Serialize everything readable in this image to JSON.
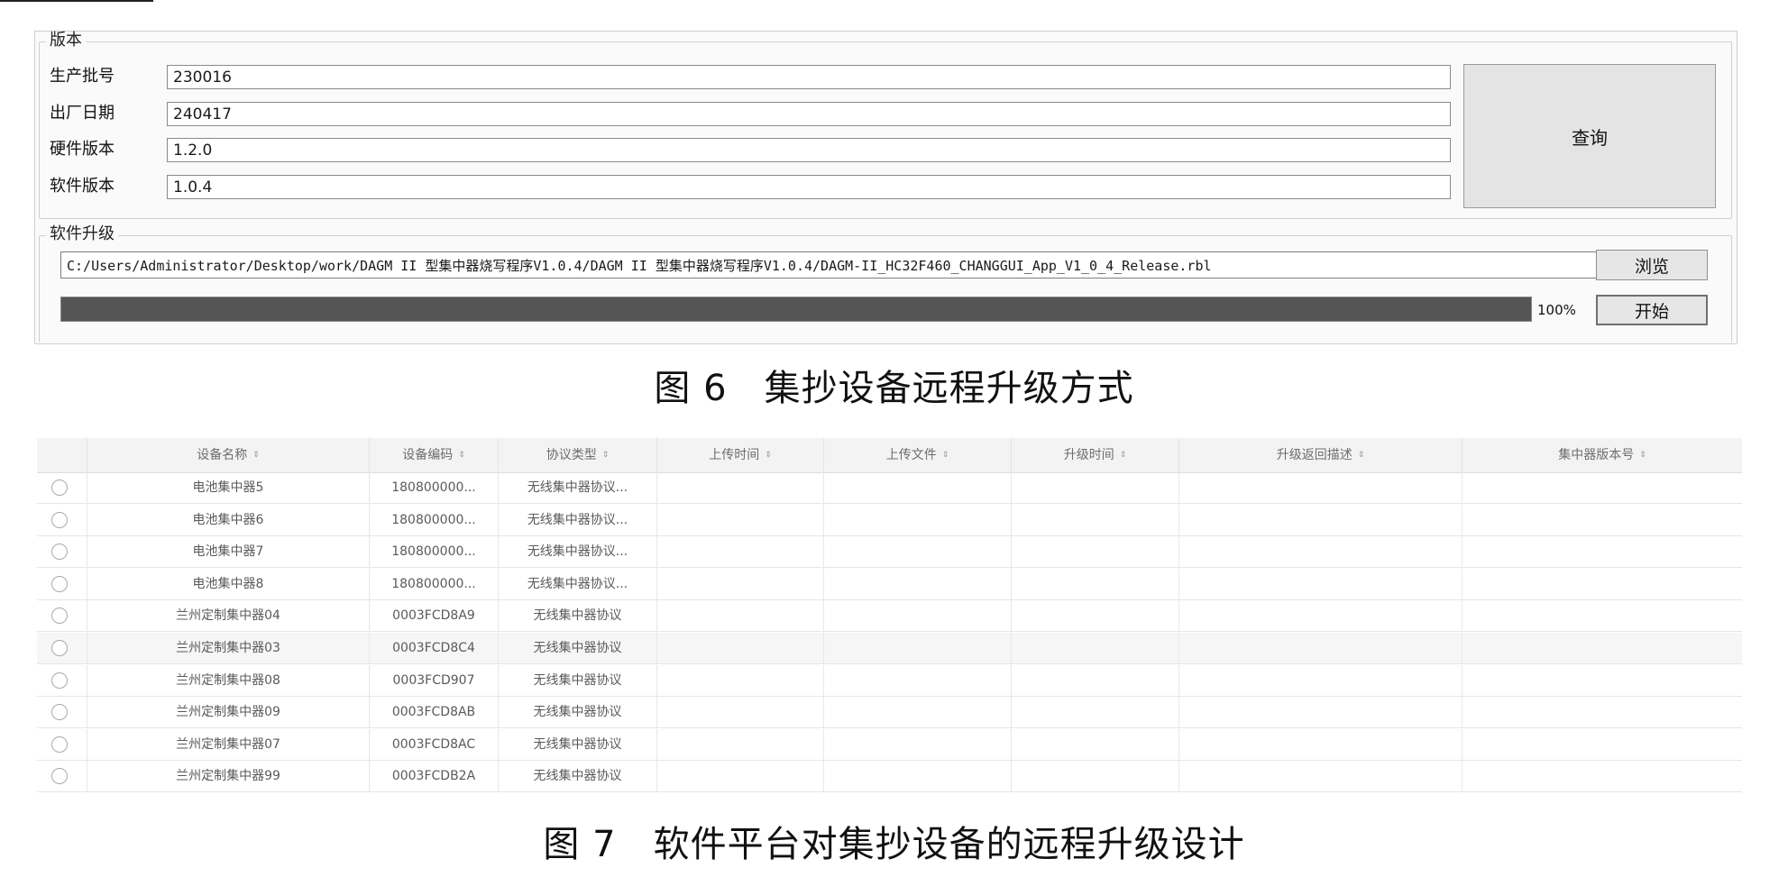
{
  "version_panel": {
    "group_title": "版本",
    "fields": [
      {
        "label": "生产批号",
        "value": "230016"
      },
      {
        "label": "出厂日期",
        "value": "240417"
      },
      {
        "label": "硬件版本",
        "value": "1.2.0"
      },
      {
        "label": "软件版本",
        "value": "1.0.4"
      }
    ],
    "query_button": "查询"
  },
  "upgrade_panel": {
    "group_title": "软件升级",
    "file_path": "C:/Users/Administrator/Desktop/work/DAGM II 型集中器烧写程序V1.0.4/DAGM II 型集中器烧写程序V1.0.4/DAGM-II_HC32F460_CHANGGUI_App_V1_0_4_Release.rbl",
    "browse_button": "浏览",
    "start_button": "开始",
    "progress_percent": 100,
    "progress_label": "100%",
    "progress_color": "#555555"
  },
  "captions": {
    "fig6": "图 6　集抄设备远程升级方式",
    "fig7": "图 7　软件平台对集抄设备的远程升级设计"
  },
  "device_table": {
    "headers": [
      "设备名称",
      "设备编码",
      "协议类型",
      "上传时间",
      "上传文件",
      "升级时间",
      "升级返回描述",
      "集中器版本号"
    ],
    "rows": [
      {
        "name": "电池集中器5",
        "code": "180800000...",
        "protocol": "无线集中器协议..."
      },
      {
        "name": "电池集中器6",
        "code": "180800000...",
        "protocol": "无线集中器协议..."
      },
      {
        "name": "电池集中器7",
        "code": "180800000...",
        "protocol": "无线集中器协议..."
      },
      {
        "name": "电池集中器8",
        "code": "180800000...",
        "protocol": "无线集中器协议..."
      },
      {
        "name": "兰州定制集中器04",
        "code": "0003FCD8A9",
        "protocol": "无线集中器协议"
      },
      {
        "name": "兰州定制集中器03",
        "code": "0003FCD8C4",
        "protocol": "无线集中器协议"
      },
      {
        "name": "兰州定制集中器08",
        "code": "0003FCD907",
        "protocol": "无线集中器协议"
      },
      {
        "name": "兰州定制集中器09",
        "code": "0003FCD8AB",
        "protocol": "无线集中器协议"
      },
      {
        "name": "兰州定制集中器07",
        "code": "0003FCD8AC",
        "protocol": "无线集中器协议"
      },
      {
        "name": "兰州定制集中器99",
        "code": "0003FCDB2A",
        "protocol": "无线集中器协议"
      }
    ]
  }
}
